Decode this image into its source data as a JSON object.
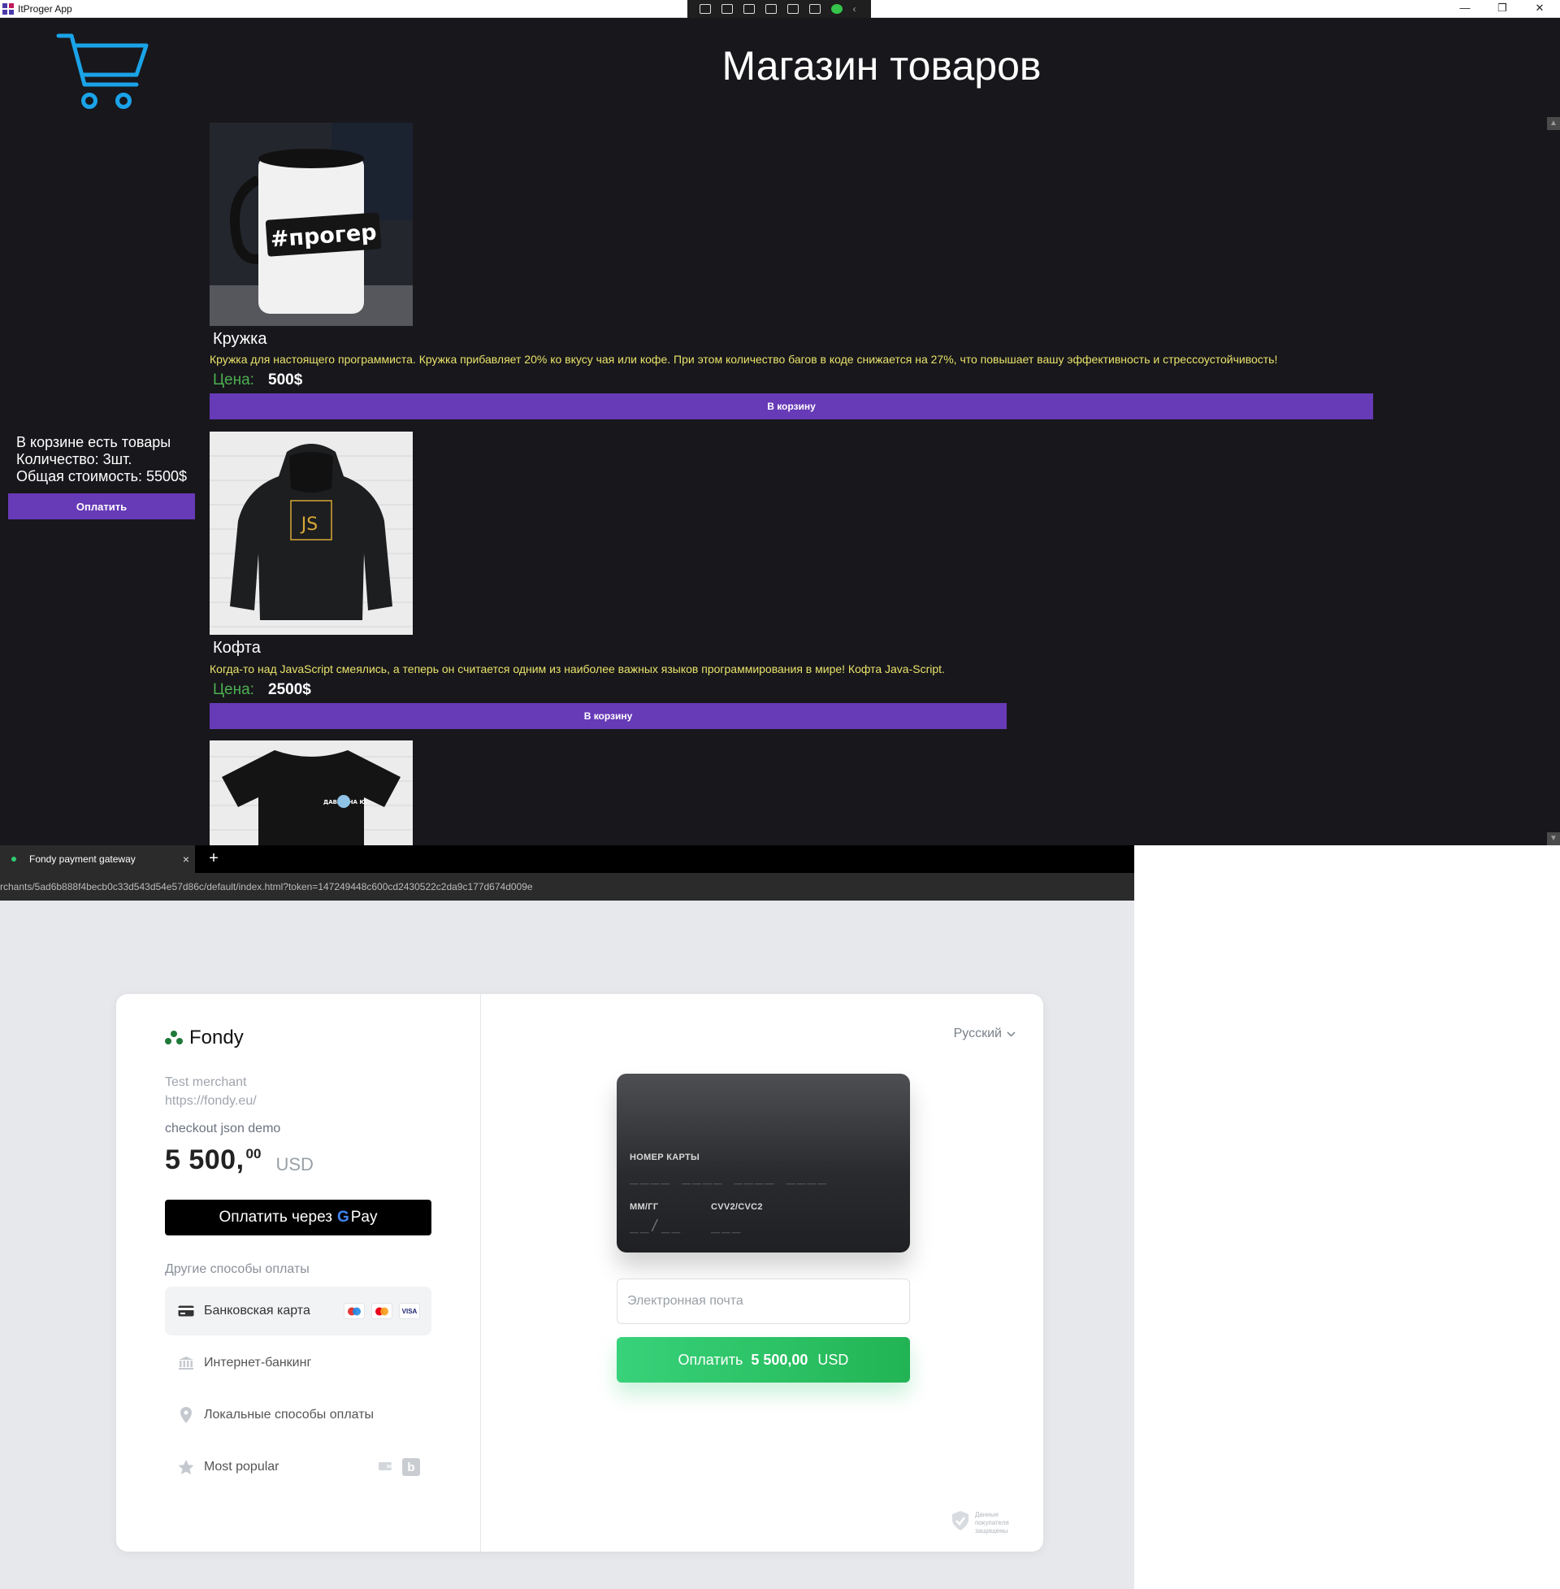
{
  "app": {
    "title": "ItProger App",
    "heading": "Магазин товаров",
    "cart_summary": {
      "line1": "В корзине есть товары",
      "line2": "Количество: 3шт.",
      "line3": "Общая стоимость: 5500$",
      "pay_button": "Оплатить"
    },
    "products": [
      {
        "name": "Кружка",
        "description": "Кружка для настоящего программиста. Кружка прибавляет 20% ко вкусу чая или кофе. При этом количество багов в коде снижается на 27%, что повышает вашу эффективность и стрессоустойчивость!",
        "price_label": "Цена:",
        "price": "500$",
        "button": "В корзину",
        "image_text": "#прогер"
      },
      {
        "name": "Кофта",
        "description": "Когда-то над JavaScript смеялись, а теперь он считается одним из наиболее важных языков программирования в мире! Кофта Java-Script.",
        "price_label": "Цена:",
        "price": "2500$",
        "button": "В корзину",
        "image_text": "JS"
      },
      {
        "image_text": "ДАВАЙ НА Ю"
      }
    ]
  },
  "browser": {
    "tab_title": "Fondy payment gateway",
    "tab_close": "×",
    "new_tab": "+",
    "url": "rchants/5ad6b888f4becb0c33d543d54e57d86c/default/index.html?token=147249448c600cd2430522c2da9c177d674d009e"
  },
  "checkout": {
    "brand": "Fondy",
    "merchant_name": "Test merchant",
    "merchant_url": "https://fondy.eu/",
    "order_description": "checkout json demo",
    "amount_main": "5 500,",
    "amount_cents": "00",
    "currency": "USD",
    "gpay_label": "Оплатить через",
    "gpay_g": "G",
    "gpay_pay": "Pay",
    "other_methods_title": "Другие способы оплаты",
    "methods": [
      {
        "label": "Банковская карта",
        "icon": "credit-card-icon",
        "active": true
      },
      {
        "label": "Интернет-банкинг",
        "icon": "bank-icon",
        "active": false
      },
      {
        "label": "Локальные способы оплаты",
        "icon": "location-pin-icon",
        "active": false
      },
      {
        "label": "Most popular",
        "icon": "star-icon",
        "active": false
      }
    ],
    "card_brand_visa": "VISA",
    "language": "Русский",
    "card": {
      "number_caption": "НОМЕР КАРТЫ",
      "number_placeholder": "____ ____ ____ ____",
      "expiry_caption": "ММ/ГГ",
      "expiry_placeholder": "__/__",
      "cvv_caption": "CVV2/CVC2",
      "cvv_placeholder": "___"
    },
    "email_placeholder": "Электронная почта",
    "submit_prefix": "Оплатить",
    "submit_amount": "5 500,00",
    "submit_currency": "USD",
    "secure_text": "Данные покупателя защищены"
  },
  "colors": {
    "app_background": "#18171c",
    "button_purple": "#673ab7",
    "description_yellow": "#e8e36a",
    "price_green": "#4caf50",
    "cart_icon_blue": "#1aa3e8",
    "pay_green": "#2ecc71"
  }
}
